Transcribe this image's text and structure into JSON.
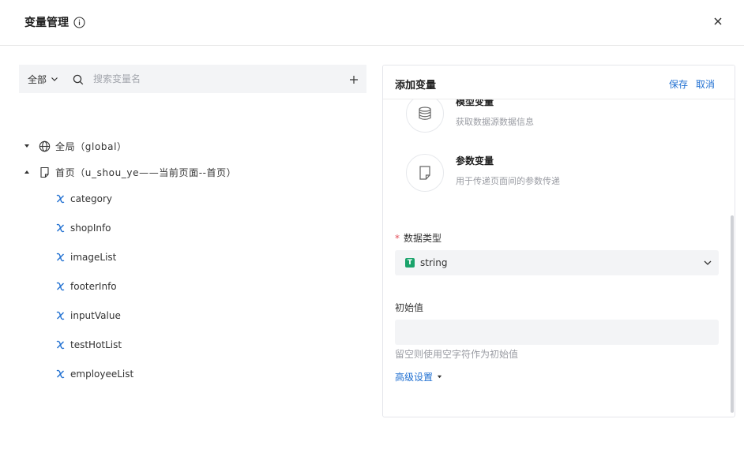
{
  "dialog": {
    "title": "变量管理",
    "close_label": "×"
  },
  "left": {
    "scope_label": "全部",
    "search_placeholder": "搜索变量名",
    "tree": {
      "global_label": "全局（global）",
      "page_label": "首页（u_shou_ye——当前页面--首页）",
      "variables": [
        "category",
        "shopInfo",
        "imageList",
        "footerInfo",
        "inputValue",
        "testHotList",
        "employeeList"
      ]
    }
  },
  "right": {
    "title": "添加变量",
    "save_label": "保存",
    "cancel_label": "取消",
    "options": [
      {
        "name": "模型变量",
        "desc": "获取数据源数据信息",
        "icon": "database-icon"
      },
      {
        "name": "参数变量",
        "desc": "用于传递页面间的参数传递",
        "icon": "document-icon"
      }
    ],
    "data_type": {
      "label": "数据类型",
      "required_mark": "*",
      "badge": "T",
      "value": "string"
    },
    "initial_value": {
      "label": "初始值",
      "value": "",
      "hint": "留空则使用空字符作为初始值"
    },
    "advanced_label": "高级设置"
  },
  "colors": {
    "accent": "#1f6fd1",
    "required": "#e34d59",
    "badge": "#1aa36b",
    "field_bg": "#f3f4f6"
  }
}
